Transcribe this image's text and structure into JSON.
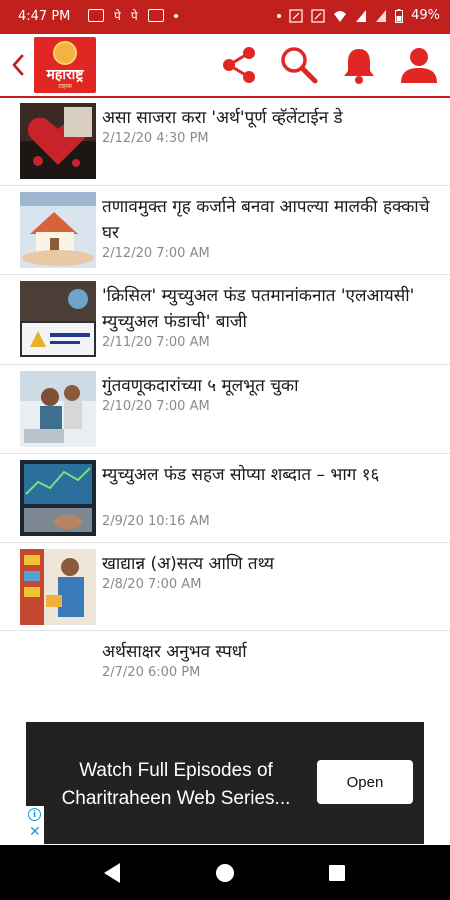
{
  "status_bar": {
    "time": "4:47 PM",
    "notification_glyphs": [
      "पे",
      "पे"
    ],
    "battery": "49%"
  },
  "app_bar": {
    "logo_text": "महाराष्ट्र",
    "logo_sub": "टाइम्स",
    "icons": [
      "back-chevron",
      "share-icon",
      "search-icon",
      "bell-icon",
      "user-icon"
    ]
  },
  "articles": [
    {
      "title": "असा साजरा करा 'अर्थ'पूर्ण व्हॅलेंटाईन डे",
      "date": "2/12/20 4:30 PM"
    },
    {
      "title": "तणावमुक्त गृह कर्जाने बनवा आपल्या मालकी हक्काचे घर",
      "date": "2/12/20 7:00 AM"
    },
    {
      "title": "'क्रिसिल' म्युच्युअल फंड पतमानांकनात 'एलआयसी' म्युच्युअल फंडाची' बाजी",
      "date": "2/11/20 7:00 AM"
    },
    {
      "title": "गुंतवणूकदारांच्या ५ मूलभूत चुका",
      "date": "2/10/20 7:00 AM"
    },
    {
      "title": "म्युच्युअल फंड सहज सोप्या शब्दात –  भाग १६",
      "date": "2/9/20 10:16 AM"
    },
    {
      "title": "खाद्यान्न (अ)सत्य आणि तथ्य",
      "date": "2/8/20 7:00 AM"
    },
    {
      "title": "अर्थसाक्षर अनुभव स्पर्धा",
      "date": "2/7/20 6:00 PM"
    }
  ],
  "ad": {
    "line1": "Watch Full Episodes of",
    "line2": "Charitraheen Web Series...",
    "cta": "Open"
  },
  "colors": {
    "brand": "#c2201c",
    "accent": "#e02724"
  }
}
